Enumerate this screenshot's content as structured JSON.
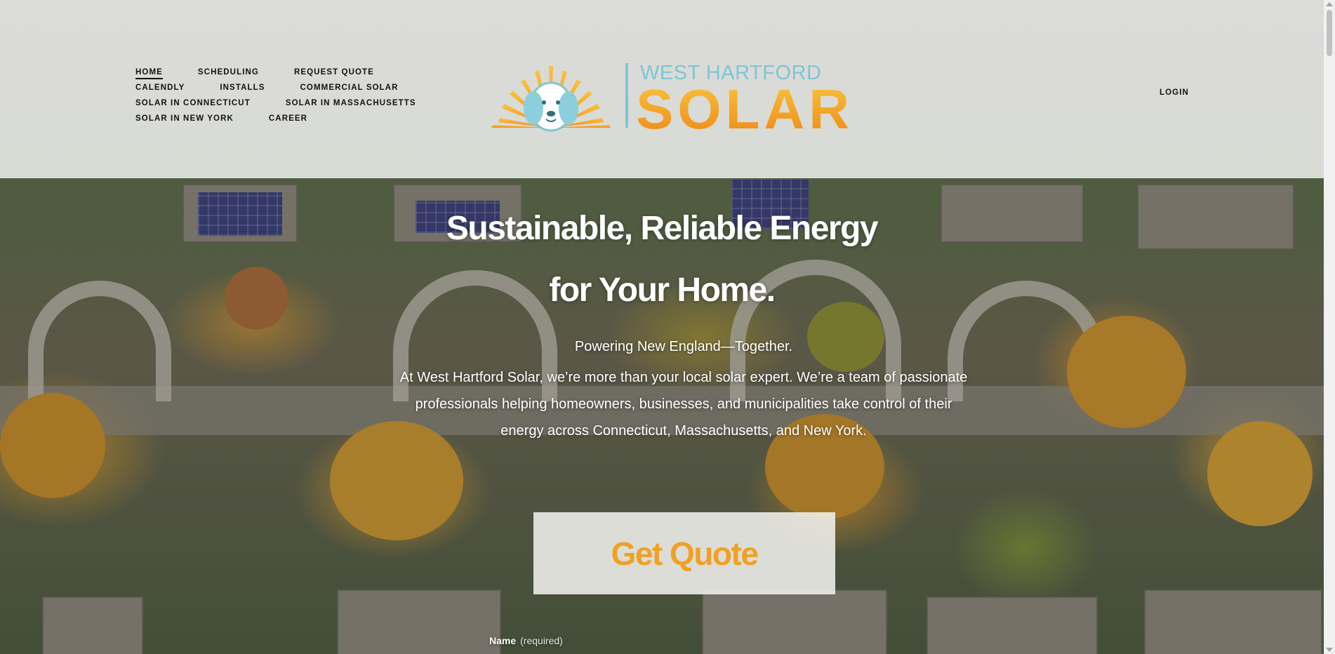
{
  "nav": {
    "rows": [
      [
        "HOME",
        "SCHEDULING",
        "REQUEST QUOTE"
      ],
      [
        "CALENDLY",
        "INSTALLS",
        "COMMERCIAL SOLAR"
      ],
      [
        "SOLAR IN CONNECTICUT",
        "SOLAR IN MASSACHUSETTS"
      ],
      [
        "SOLAR IN NEW YORK",
        "CAREER"
      ]
    ],
    "active": "HOME",
    "login": "LOGIN"
  },
  "logo": {
    "top_text": "WEST HARTFORD",
    "bottom_text": "SOLAR",
    "icon": "dog-sunburst-logo-icon"
  },
  "hero": {
    "title_line1": "Sustainable, Reliable Energy",
    "title_line2": "for Your Home.",
    "tagline": "Powering New England—Together.",
    "body": "At West Hartford Solar, we’re more than your local solar expert. We’re a team of passionate professionals helping homeowners, businesses, and municipalities take control of their energy across Connecticut, Massachusetts, and New York.",
    "cta_label": "Get Quote"
  },
  "form": {
    "name_label": "Name",
    "name_required": "(required)"
  },
  "colors": {
    "accent_orange": "#f0a024",
    "logo_teal": "#7fc5d3",
    "header_bg": "rgba(255,255,255,0.78)"
  }
}
